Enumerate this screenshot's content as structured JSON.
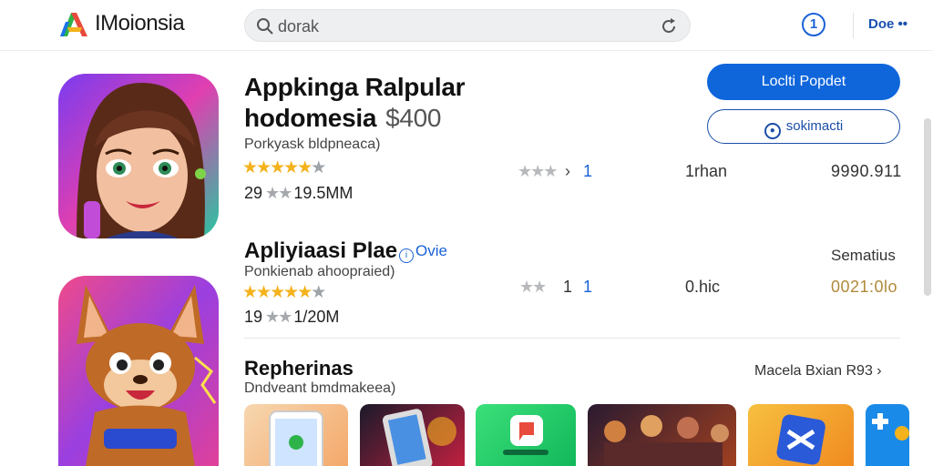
{
  "header": {
    "brand": "IMoionsia",
    "search_value": "dorak",
    "info_label": "1",
    "more_label": "Doe"
  },
  "row1": {
    "title_line1": "Appkinga Ralpular",
    "title_line2": "hodomesia",
    "price": "$400",
    "subtitle": "Porkyask bldpneaca)",
    "rating_stars": 4.5,
    "meta_count": "29",
    "meta_size": "19.5MM",
    "col_number": "1",
    "col_label": "1rhan",
    "col_value": "9990.911",
    "primary_button": "Loclti Popdet",
    "secondary_button": "sokimacti"
  },
  "row2": {
    "title": "Apliyiaasi Plae",
    "badge": "Ovie",
    "subtitle": "Ponkienab ahoopraied)",
    "rating_stars": 4.5,
    "meta_count": "19",
    "meta_size": "1/20M",
    "faint_number": "1",
    "col_number": "1",
    "col_label": "0.hic",
    "col_value": "0021:0lo",
    "right_label": "Sematius"
  },
  "section": {
    "title": "Repherinas",
    "subtitle": "Dndveant bmdmakeea)",
    "see_all": "Macela Bxian R93"
  },
  "colors": {
    "accent": "#0f66db",
    "star": "#f4b21c",
    "gold_value": "#b08a3a"
  }
}
